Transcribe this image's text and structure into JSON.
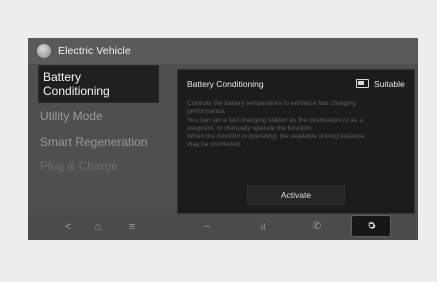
{
  "header": {
    "title": "Electric Vehicle"
  },
  "sidebar": {
    "items": [
      {
        "label_line1": "Battery",
        "label_line2": "Conditioning"
      },
      {
        "label": "Utility Mode"
      },
      {
        "label": "Smart Regeneration"
      },
      {
        "label": "Plug & Charge"
      }
    ]
  },
  "panel": {
    "title": "Battery Conditioning",
    "status": "Suitable",
    "description": [
      "Controls the battery temperature to enhance fast charging",
      "performance.",
      "You can set a fast charging station as the destination or as a",
      "waypoint, or manually operate the function.",
      "When the function is operating, the available driving distance",
      "may be shortened."
    ],
    "activate_label": "Activate"
  },
  "navbar": {
    "back": "<",
    "home": "⌂",
    "menu": "≡",
    "climate": "~",
    "signal": "ıl",
    "phone": "✆"
  }
}
